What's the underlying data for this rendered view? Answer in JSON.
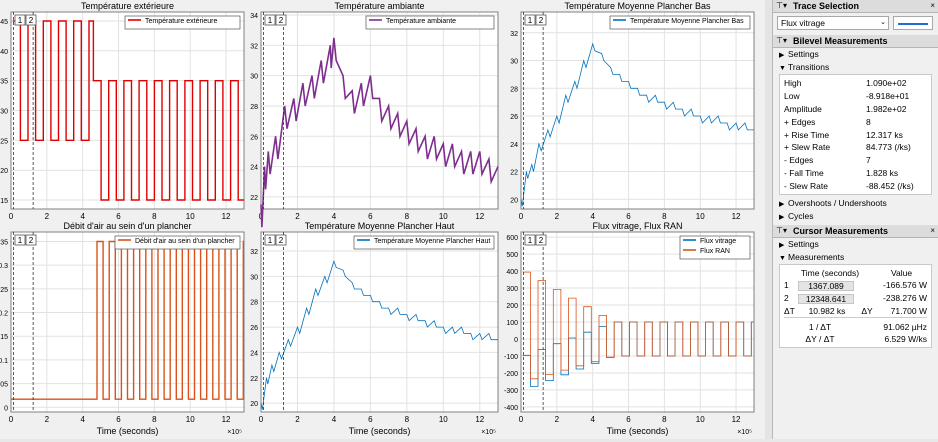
{
  "plots": [
    {
      "id": "p1",
      "title": "Température extérieure",
      "legend": [
        "Température extérieure"
      ],
      "colors": [
        "#e00000"
      ],
      "xlabel": "",
      "ticks_y": [
        "15",
        "20",
        "25",
        "30",
        "35",
        "40",
        "45"
      ],
      "ylim": [
        13.5,
        46.5
      ],
      "ticks_x": [
        "0",
        "2",
        "4",
        "6",
        "8",
        "10",
        "12"
      ],
      "exp": "",
      "cursor_buttons": [
        "1",
        "2"
      ]
    },
    {
      "id": "p2",
      "title": "Température ambiante",
      "legend": [
        "Température ambiante"
      ],
      "colors": [
        "#7e2f8e"
      ],
      "xlabel": "",
      "ticks_y": [
        "22",
        "24",
        "26",
        "28",
        "30",
        "32",
        "34"
      ],
      "ylim": [
        21.2,
        34.2
      ],
      "ticks_x": [
        "0",
        "2",
        "4",
        "6",
        "8",
        "10",
        "12"
      ],
      "exp": "",
      "cursor_buttons": [
        "1",
        "2"
      ]
    },
    {
      "id": "p3",
      "title": "Température Moyenne Plancher Bas",
      "legend": [
        "Température Moyenne Plancher Bas"
      ],
      "colors": [
        "#0072bd"
      ],
      "xlabel": "",
      "ticks_y": [
        "20",
        "22",
        "24",
        "26",
        "28",
        "30",
        "32"
      ],
      "ylim": [
        19.3,
        33.5
      ],
      "ticks_x": [
        "0",
        "2",
        "4",
        "6",
        "8",
        "10",
        "12"
      ],
      "exp": "",
      "cursor_buttons": [
        "1",
        "2"
      ]
    },
    {
      "id": "p4",
      "title": "Débit d'air au sein d'un plancher",
      "legend": [
        "Débit d'air au sein d'un plancher"
      ],
      "colors": [
        "#d95319"
      ],
      "xlabel": "Time (seconds)",
      "ticks_y": [
        "0",
        "0.05",
        "0.1",
        "0.15",
        "0.2",
        "0.25",
        "0.3",
        "0.35"
      ],
      "ylim": [
        -0.01,
        0.37
      ],
      "ticks_x": [
        "0",
        "2",
        "4",
        "6",
        "8",
        "10",
        "12"
      ],
      "exp": "×10⁵",
      "cursor_buttons": [
        "1",
        "2"
      ]
    },
    {
      "id": "p5",
      "title": "Température Moyenne Plancher Haut",
      "legend": [
        "Température Moyenne Plancher Haut"
      ],
      "colors": [
        "#0072bd"
      ],
      "xlabel": "Time (seconds)",
      "ticks_y": [
        "20",
        "22",
        "24",
        "26",
        "28",
        "30",
        "32"
      ],
      "ylim": [
        19.3,
        33.5
      ],
      "ticks_x": [
        "0",
        "2",
        "4",
        "6",
        "8",
        "10",
        "12"
      ],
      "exp": "×10⁵",
      "cursor_buttons": [
        "1",
        "2"
      ]
    },
    {
      "id": "p6",
      "title": "Flux vitrage, Flux RAN",
      "legend": [
        "Flux vitrage",
        "Flux RAN"
      ],
      "colors": [
        "#0072bd",
        "#d95319"
      ],
      "xlabel": "Time (seconds)",
      "ticks_y": [
        "-400",
        "-300",
        "-200",
        "-100",
        "0",
        "100",
        "200",
        "300",
        "400",
        "500",
        "600"
      ],
      "ylim": [
        -430,
        630
      ],
      "ticks_x": [
        "0",
        "2",
        "4",
        "6",
        "8",
        "10",
        "12"
      ],
      "exp": "×10⁵",
      "cursor_buttons": [
        "1",
        "2"
      ]
    }
  ],
  "chart_data": {
    "type": "line",
    "x_unit": "seconds (×10⁵)",
    "xlim": [
      0,
      13
    ],
    "cursor1_x": 0.137,
    "cursor2_x": 1.235,
    "p1_temp_ext": {
      "high": 45,
      "low": 25,
      "high2": 35,
      "low2": 15,
      "switch_x": 4.6,
      "period": 0.85
    },
    "p2_amb": [
      [
        0,
        21.5
      ],
      [
        0.2,
        24
      ],
      [
        0.4,
        25
      ],
      [
        0.8,
        26
      ],
      [
        1.3,
        28
      ],
      [
        1.8,
        28.5
      ],
      [
        2.3,
        29.5
      ],
      [
        2.8,
        30
      ],
      [
        3.3,
        31
      ],
      [
        3.8,
        32
      ],
      [
        4.0,
        32.5
      ],
      [
        4.5,
        30
      ],
      [
        5,
        29
      ],
      [
        5.5,
        29.5
      ],
      [
        6,
        30
      ],
      [
        6.5,
        28.5
      ],
      [
        7,
        28
      ],
      [
        7.5,
        27.5
      ],
      [
        8,
        27
      ],
      [
        8.5,
        26.5
      ],
      [
        9,
        26
      ],
      [
        9.5,
        26
      ],
      [
        10,
        25.5
      ],
      [
        10.5,
        25.5
      ],
      [
        11,
        25
      ],
      [
        11.5,
        25
      ],
      [
        12,
        25
      ],
      [
        12.5,
        24.5
      ],
      [
        13,
        24
      ]
    ],
    "p3_plancher_bas": [
      [
        0,
        20
      ],
      [
        0.3,
        22
      ],
      [
        0.6,
        22.5
      ],
      [
        1,
        24
      ],
      [
        1.5,
        25
      ],
      [
        2,
        26
      ],
      [
        2.5,
        27.5
      ],
      [
        3,
        28.5
      ],
      [
        3.5,
        30
      ],
      [
        4,
        31.2
      ],
      [
        4.5,
        30.5
      ],
      [
        5,
        29.5
      ],
      [
        5.5,
        29
      ],
      [
        6,
        28.5
      ],
      [
        6.5,
        28
      ],
      [
        7,
        27.5
      ],
      [
        7.5,
        27.5
      ],
      [
        8,
        27
      ],
      [
        8.5,
        27
      ],
      [
        9,
        26.5
      ],
      [
        9.5,
        26.5
      ],
      [
        10,
        26
      ],
      [
        10.5,
        26
      ],
      [
        11,
        26
      ],
      [
        11.5,
        25.5
      ],
      [
        12,
        25.5
      ],
      [
        12.5,
        25.5
      ],
      [
        13,
        25
      ]
    ],
    "p4_debit": {
      "low": 0.017,
      "high": 0.35,
      "start_x": 4.8,
      "period": 0.68
    },
    "p5_plancher_haut": [
      [
        0,
        20
      ],
      [
        0.3,
        22
      ],
      [
        0.6,
        23
      ],
      [
        1,
        24
      ],
      [
        1.5,
        25
      ],
      [
        2,
        26
      ],
      [
        2.5,
        27.5
      ],
      [
        3,
        29
      ],
      [
        3.5,
        30
      ],
      [
        4,
        31.2
      ],
      [
        4.5,
        30.5
      ],
      [
        5,
        29.5
      ],
      [
        5.5,
        29
      ],
      [
        6,
        28.5
      ],
      [
        6.5,
        28
      ],
      [
        7,
        27.5
      ],
      [
        7.5,
        27.5
      ],
      [
        8,
        27
      ],
      [
        8.5,
        27
      ],
      [
        9,
        26.5
      ],
      [
        9.5,
        26.5
      ],
      [
        10,
        26
      ],
      [
        10.5,
        26
      ],
      [
        11,
        26
      ],
      [
        11.5,
        25.5
      ],
      [
        12,
        25.5
      ],
      [
        12.5,
        25.5
      ],
      [
        13,
        25
      ]
    ],
    "p6_flux_vitrage": {
      "start": -200,
      "end_mid": 0,
      "amp": 100,
      "period": 0.85
    },
    "p6_flux_ran": {
      "start_high": 400,
      "start_low": -250,
      "end_high": 100,
      "end_low": -100,
      "period": 0.85
    }
  },
  "panel": {
    "trace_selection": {
      "title": "Trace Selection",
      "value": "Flux vitrage",
      "close": "×"
    },
    "bilevel": {
      "title": "Bilevel Measurements",
      "settings": "Settings",
      "transitions": "Transitions",
      "rows": [
        {
          "k": "High",
          "v": "1.090e+02"
        },
        {
          "k": "Low",
          "v": "-8.918e+01"
        },
        {
          "k": "Amplitude",
          "v": "1.982e+02"
        },
        {
          "k": "+ Edges",
          "v": "8"
        },
        {
          "k": "+ Rise Time",
          "v": "12.317 ks"
        },
        {
          "k": "+ Slew Rate",
          "v": "84.773 (/ks)"
        },
        {
          "k": "- Edges",
          "v": "7"
        },
        {
          "k": "- Fall Time",
          "v": "1.828 ks"
        },
        {
          "k": "- Slew Rate",
          "v": "-88.452 (/ks)"
        }
      ],
      "overshoots": "Overshoots / Undershoots",
      "cycles": "Cycles"
    },
    "cursor": {
      "title": "Cursor Measurements",
      "settings": "Settings",
      "measurements": "Measurements",
      "col_time": "Time (seconds)",
      "col_value": "Value",
      "c1_label": "1",
      "c1_time": "1367.089",
      "c1_value": "-166.576 W",
      "c2_label": "2",
      "c2_time": "12348.641",
      "c2_value": "-238.276 W",
      "dt_label": "ΔT",
      "dt": "10.982 ks",
      "dy_label": "ΔY",
      "dy": "71.700 W",
      "inv_dt_label": "1 / ΔT",
      "inv_dt": "91.062 µHz",
      "dydt_label": "ΔY / ΔT",
      "dydt": "6.529 W/ks"
    }
  }
}
